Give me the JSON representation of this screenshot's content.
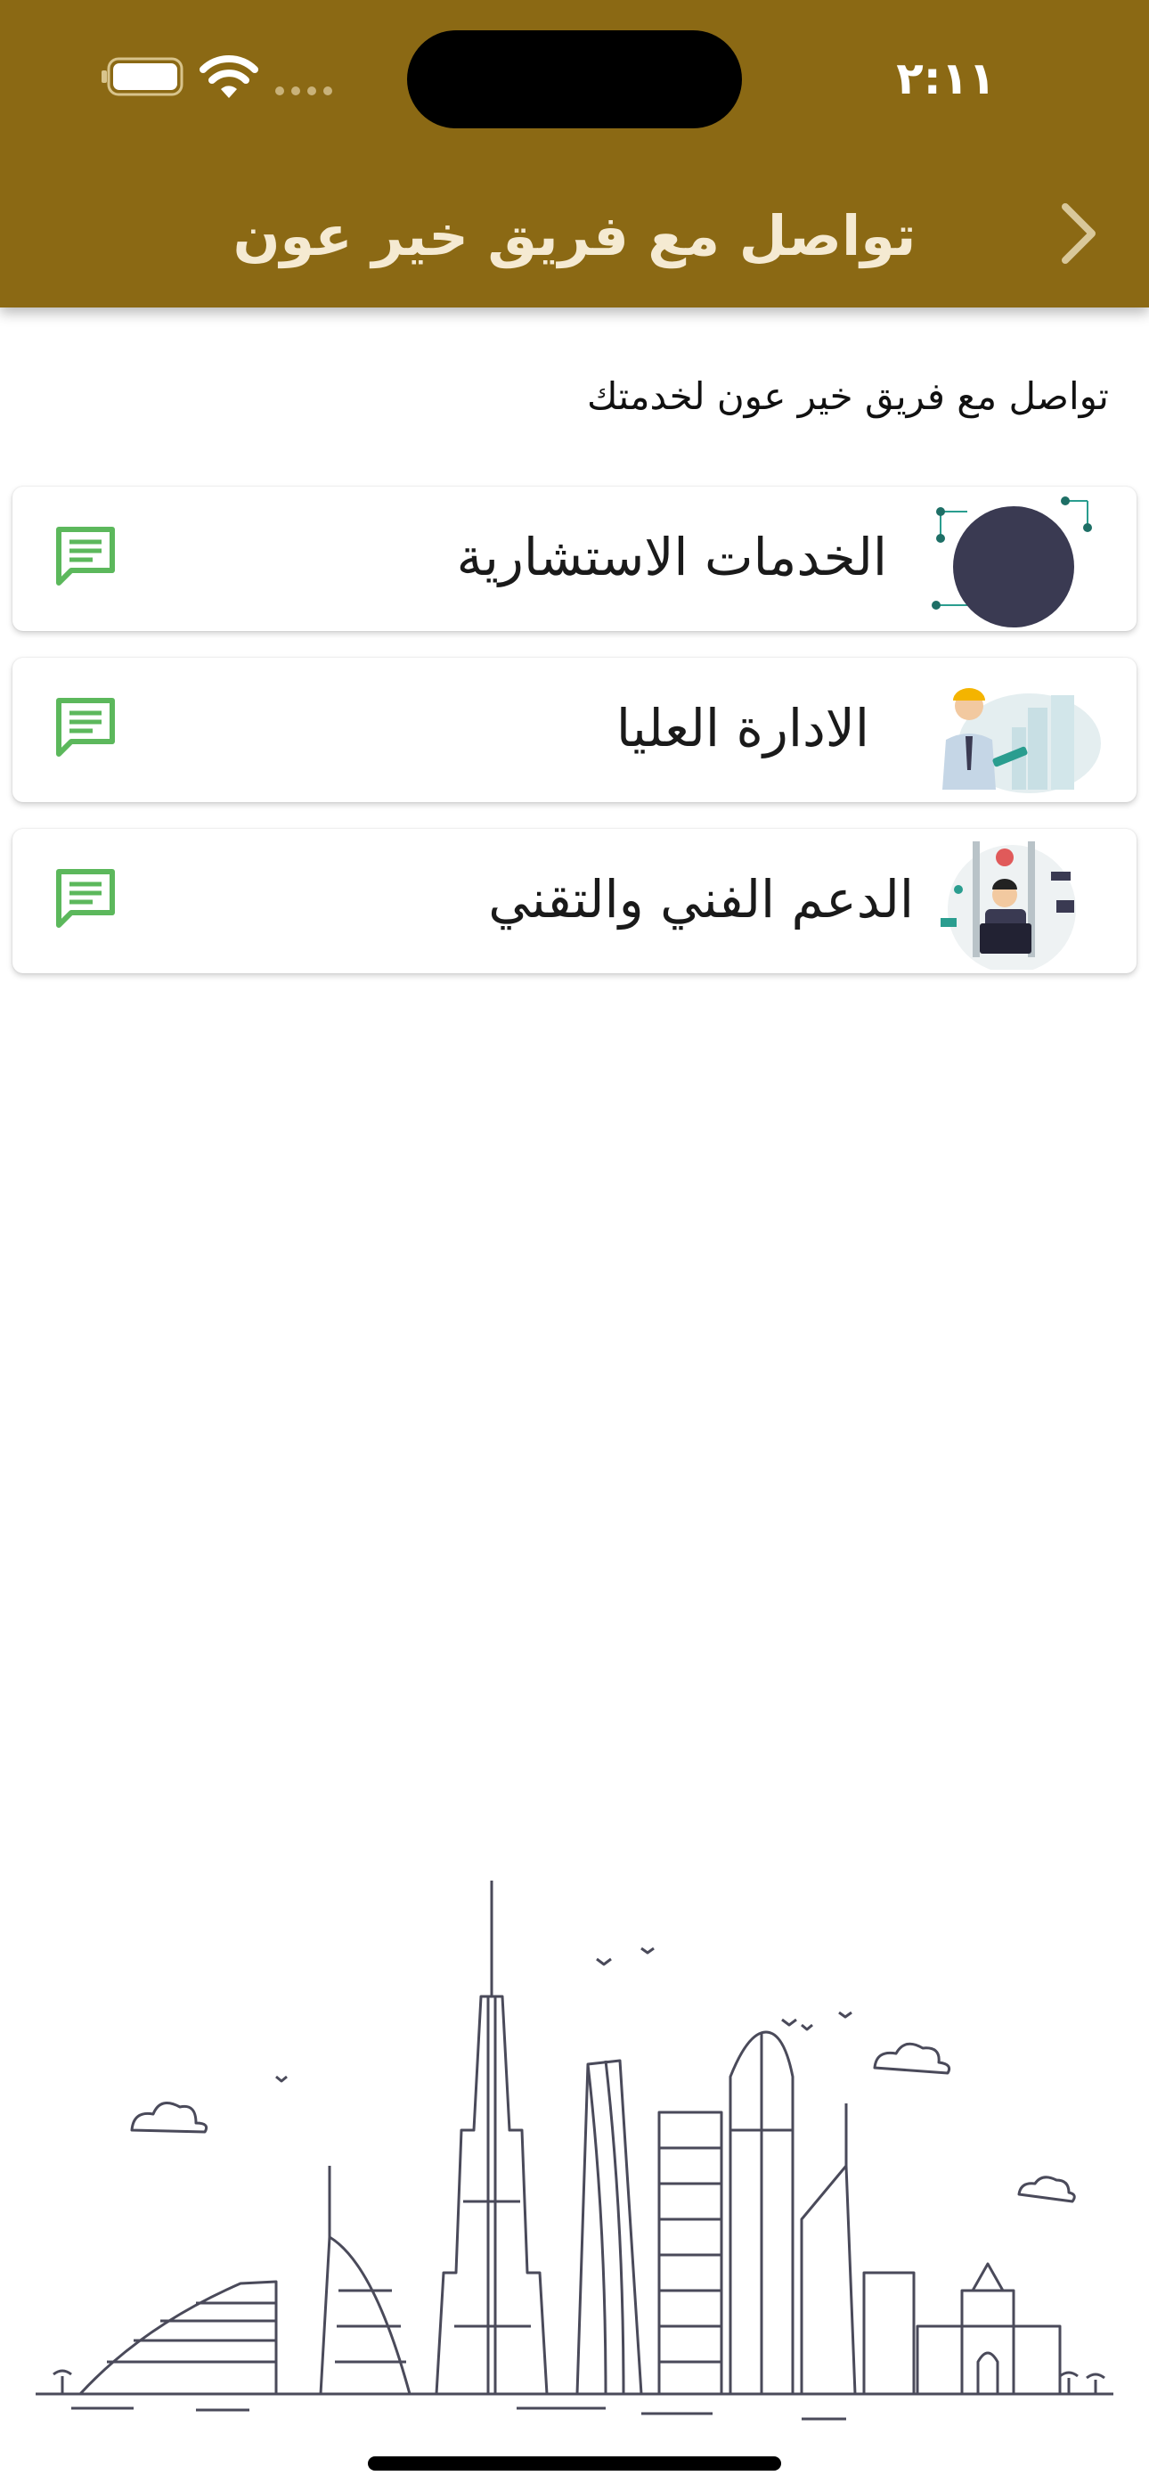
{
  "status_bar": {
    "time": "٢:١١"
  },
  "header": {
    "title": "تواصل مع فريق خير عون"
  },
  "subtitle": "تواصل مع فريق خير عون لخدمتك",
  "cards": [
    {
      "label": "الخدمات الاستشارية"
    },
    {
      "label": "الادارة العليا"
    },
    {
      "label": "الدعم الفني والتقني"
    }
  ],
  "colors": {
    "header": "#8b6914",
    "chat_icon": "#5cb85c",
    "card_text": "#1a1a1a"
  },
  "icons": {
    "back": "chevron-right-icon",
    "chat": "chat-message-icon"
  }
}
